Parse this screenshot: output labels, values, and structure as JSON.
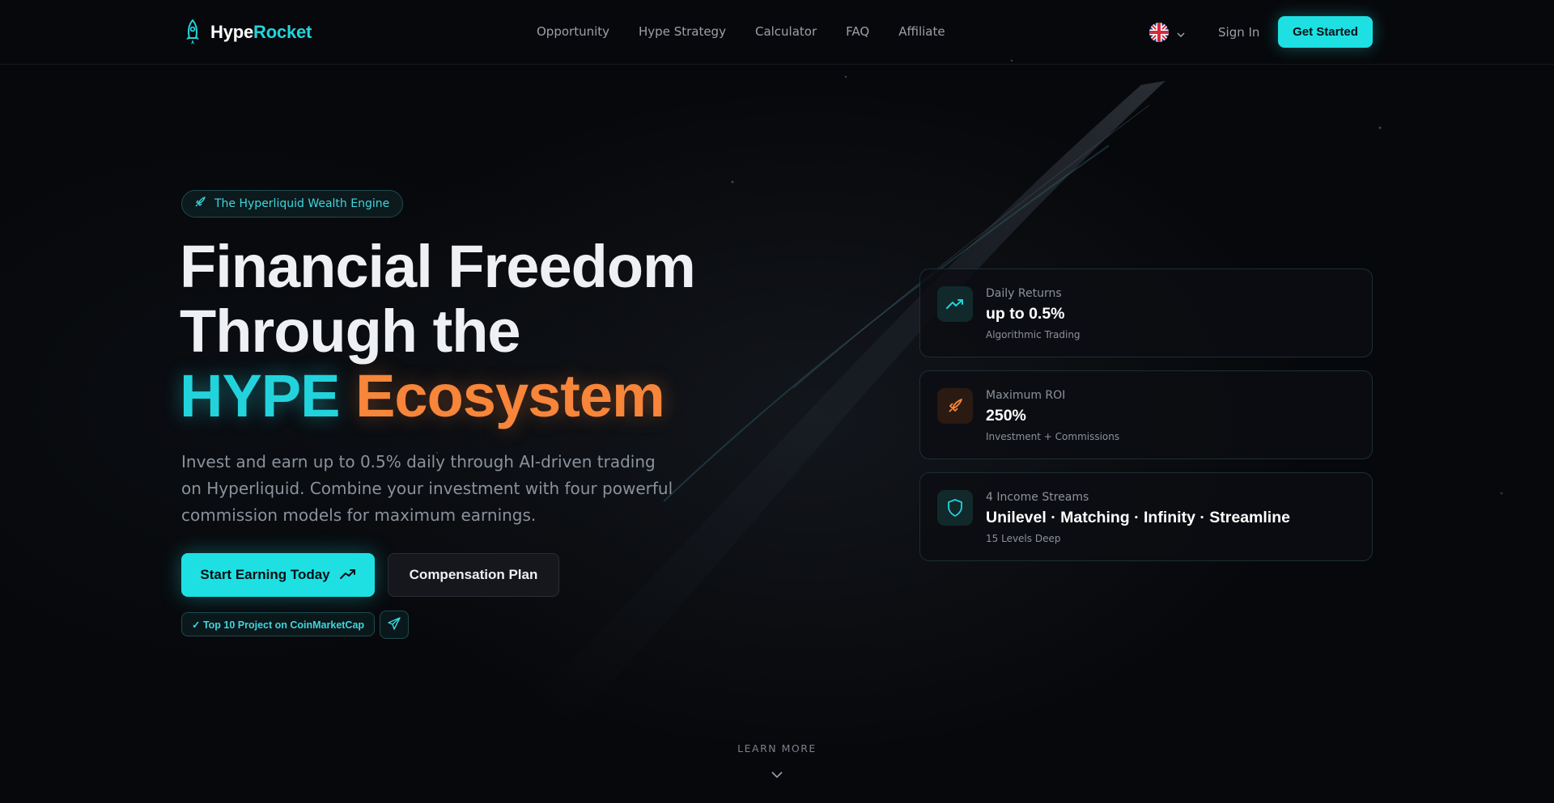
{
  "brand": {
    "name_part1": "Hype",
    "name_part2": "Rocket"
  },
  "nav": {
    "items": [
      {
        "label": "Opportunity"
      },
      {
        "label": "Hype Strategy"
      },
      {
        "label": "Calculator"
      },
      {
        "label": "FAQ"
      },
      {
        "label": "Affiliate"
      }
    ]
  },
  "header": {
    "language_icon": "uk-flag-icon",
    "sign_in_label": "Sign In",
    "get_started_label": "Get Started"
  },
  "hero": {
    "badge": "The Hyperliquid Wealth Engine",
    "title_line1": "Financial Freedom",
    "title_line2": "Through the",
    "title_highlight1": "HYPE",
    "title_highlight2": "Ecosystem",
    "subtitle": "Invest and earn up to 0.5% daily through AI-driven trading on Hyperliquid. Combine your investment with four powerful commission models for maximum earnings.",
    "primary_cta": "Start Earning Today",
    "secondary_cta": "Compensation Plan",
    "cmc_badge": "✓ Top 10 Project on CoinMarketCap"
  },
  "cards": [
    {
      "icon": "trending-up-icon",
      "label": "Daily Returns",
      "value": "up to 0.5%",
      "sub": "Algorithmic Trading"
    },
    {
      "icon": "rocket-icon",
      "label": "Maximum ROI",
      "value": "250%",
      "sub": "Investment + Commissions"
    },
    {
      "icon": "shield-icon",
      "label": "4 Income Streams",
      "value": "Unilevel · Matching · Infinity · Streamline",
      "sub": "15 Levels Deep"
    }
  ],
  "footer": {
    "learn_more": "LEARN MORE"
  },
  "colors": {
    "accent": "#1ee0e3",
    "orange": "#f7853a",
    "background": "#07080b"
  }
}
